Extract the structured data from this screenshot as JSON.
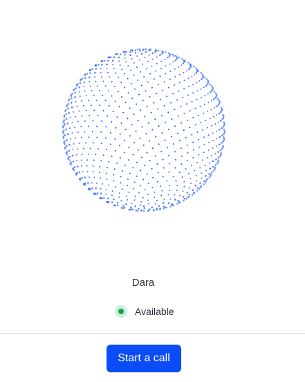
{
  "agent": {
    "name": "Dara",
    "status_label": "Available",
    "status_color": "#16a34a"
  },
  "visualizer": {
    "icon": "dotted-sphere-icon",
    "dot_color": "#0a4cf5"
  },
  "actions": {
    "start_call_label": "Start a call",
    "button_color": "#0a4cf5"
  }
}
